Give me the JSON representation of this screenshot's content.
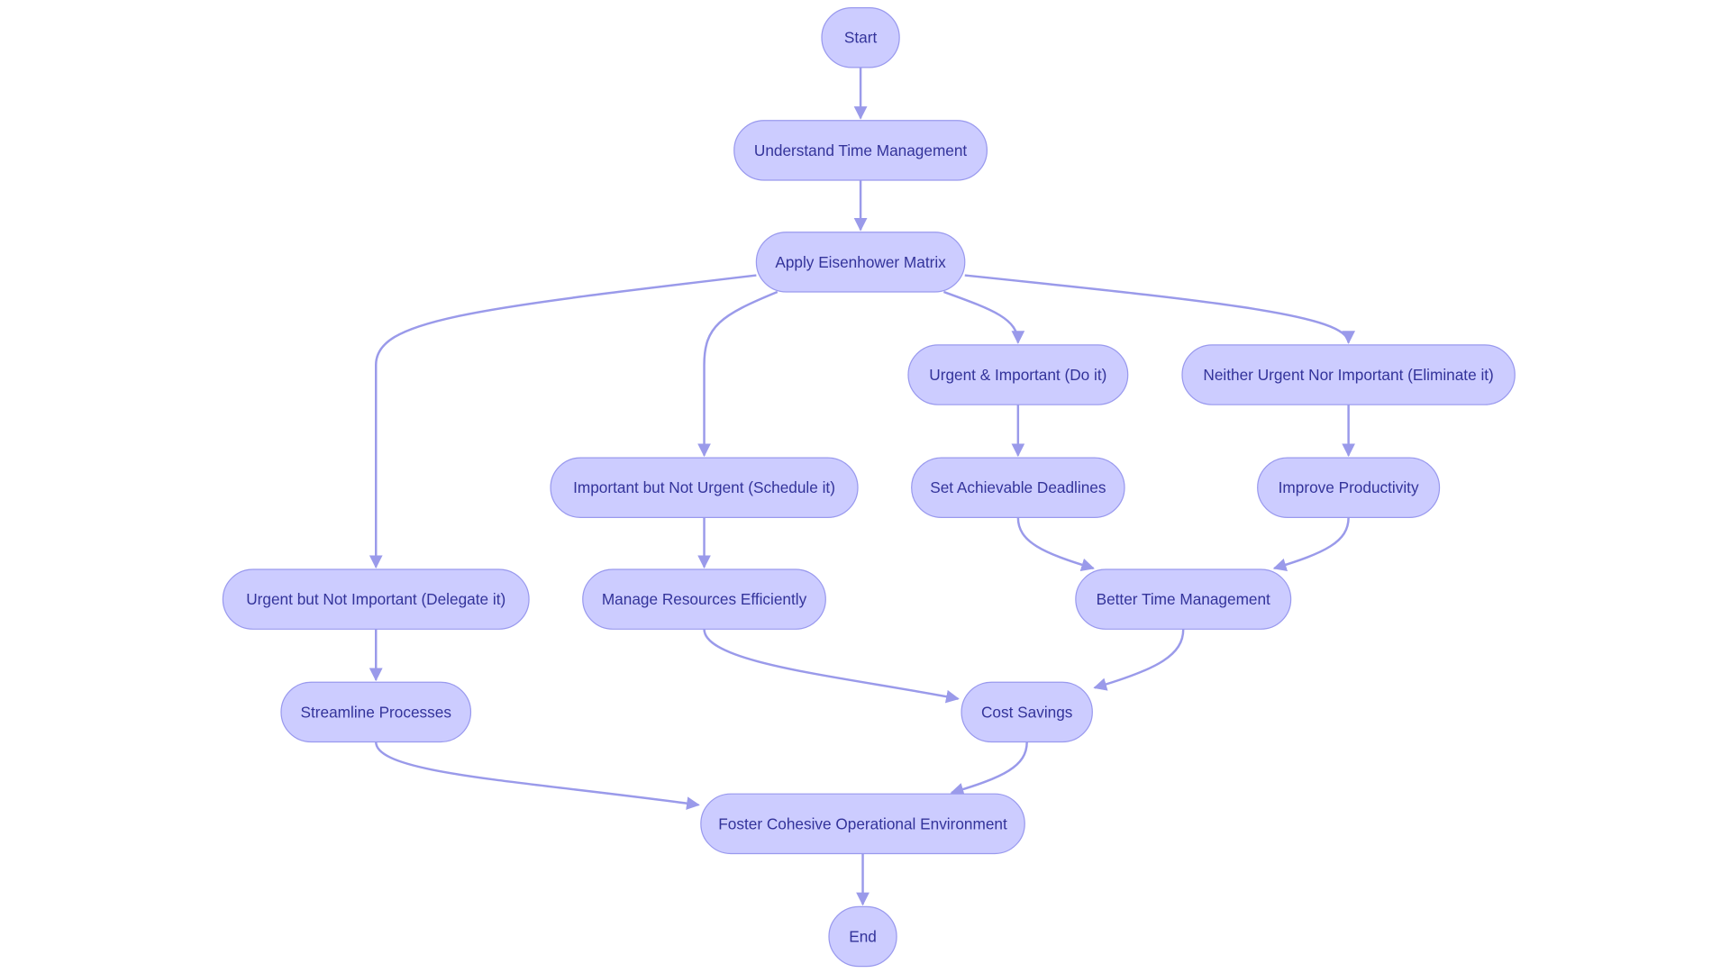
{
  "diagram": {
    "type": "flowchart",
    "direction": "top-down",
    "colors": {
      "node_fill": "#ccccff",
      "node_border": "#9999ee",
      "node_text": "#33339a",
      "edge": "#9a9aea",
      "background": "#ffffff"
    },
    "nodes": [
      {
        "id": "start",
        "label": "Start"
      },
      {
        "id": "understand",
        "label": "Understand Time Management"
      },
      {
        "id": "eisenhower",
        "label": "Apply Eisenhower Matrix"
      },
      {
        "id": "urgent_important",
        "label": "Urgent & Important (Do it)"
      },
      {
        "id": "neither",
        "label": "Neither Urgent Nor Important (Eliminate it)"
      },
      {
        "id": "important_not_urgent",
        "label": "Important but Not Urgent (Schedule it)"
      },
      {
        "id": "deadlines",
        "label": "Set Achievable Deadlines"
      },
      {
        "id": "productivity",
        "label": "Improve Productivity"
      },
      {
        "id": "urgent_not_important",
        "label": "Urgent but Not Important (Delegate it)"
      },
      {
        "id": "resources",
        "label": "Manage Resources Efficiently"
      },
      {
        "id": "better_time",
        "label": "Better Time Management"
      },
      {
        "id": "streamline",
        "label": "Streamline Processes"
      },
      {
        "id": "cost_savings",
        "label": "Cost Savings"
      },
      {
        "id": "foster",
        "label": "Foster Cohesive Operational Environment"
      },
      {
        "id": "end",
        "label": "End"
      }
    ],
    "edges": [
      {
        "from": "start",
        "to": "understand"
      },
      {
        "from": "understand",
        "to": "eisenhower"
      },
      {
        "from": "eisenhower",
        "to": "urgent_not_important"
      },
      {
        "from": "eisenhower",
        "to": "important_not_urgent"
      },
      {
        "from": "eisenhower",
        "to": "urgent_important"
      },
      {
        "from": "eisenhower",
        "to": "neither"
      },
      {
        "from": "urgent_important",
        "to": "deadlines"
      },
      {
        "from": "neither",
        "to": "productivity"
      },
      {
        "from": "important_not_urgent",
        "to": "resources"
      },
      {
        "from": "deadlines",
        "to": "better_time"
      },
      {
        "from": "productivity",
        "to": "better_time"
      },
      {
        "from": "urgent_not_important",
        "to": "streamline"
      },
      {
        "from": "resources",
        "to": "cost_savings"
      },
      {
        "from": "better_time",
        "to": "cost_savings"
      },
      {
        "from": "streamline",
        "to": "foster"
      },
      {
        "from": "cost_savings",
        "to": "foster"
      },
      {
        "from": "foster",
        "to": "end"
      }
    ]
  }
}
